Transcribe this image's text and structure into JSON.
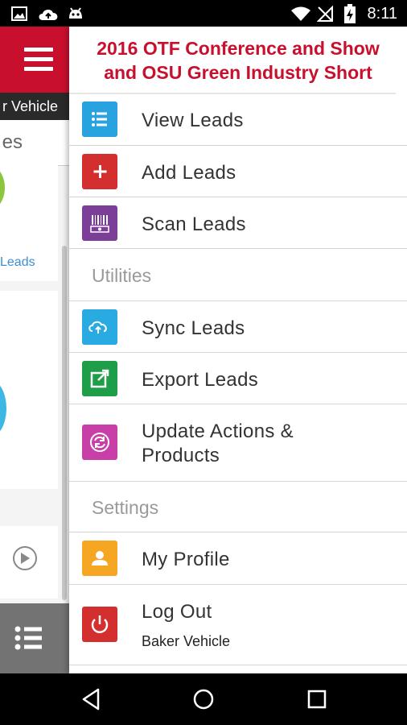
{
  "status_bar": {
    "time": "8:11",
    "icons": [
      "image-icon",
      "cloud-upload-icon",
      "android-icon",
      "wifi-icon",
      "no-signal-icon",
      "battery-charging-icon"
    ]
  },
  "background_app": {
    "header_icon": "hamburger-menu-icon",
    "vehicle_label": "r Vehicle",
    "search_text": "es",
    "card_link": "Leads",
    "bottom_icon": "list-icon"
  },
  "drawer": {
    "title_line1": "2016 OTF Conference and Show",
    "title_line2": "and OSU Green Industry Short",
    "menu": [
      {
        "label": "View Leads",
        "icon": "list-icon",
        "color": "#29a3e0"
      },
      {
        "label": "Add Leads",
        "icon": "plus-icon",
        "color": "#d32f2f"
      },
      {
        "label": "Scan Leads",
        "icon": "barcode-scan-icon",
        "color": "#7b3f98"
      }
    ],
    "utilities_header": "Utilities",
    "utilities": [
      {
        "label": "Sync Leads",
        "icon": "cloud-sync-icon",
        "color": "#29abe2"
      },
      {
        "label": "Export Leads",
        "icon": "export-icon",
        "color": "#1e9e48"
      },
      {
        "label_line1": "Update Actions &",
        "label_line2": "Products",
        "icon": "refresh-icon",
        "color": "#c93fa8"
      }
    ],
    "settings_header": "Settings",
    "settings": [
      {
        "label": "My Profile",
        "icon": "person-icon",
        "color": "#f5a623"
      },
      {
        "label": "Log Out",
        "sublabel": "Baker Vehicle",
        "icon": "power-icon",
        "color": "#d32f2f"
      }
    ]
  },
  "nav_bar": {
    "buttons": [
      "back-icon",
      "home-icon",
      "recents-icon"
    ]
  }
}
